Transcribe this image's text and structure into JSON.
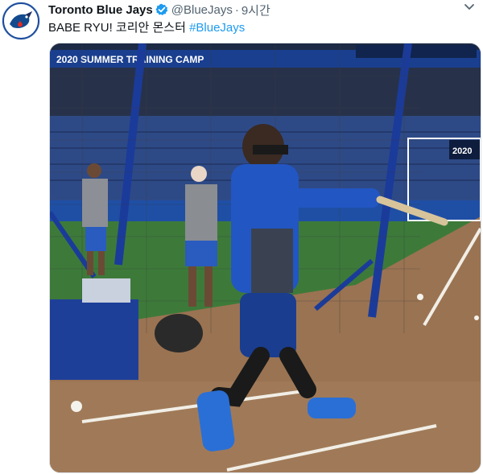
{
  "tweet": {
    "account_name": "Toronto Blue Jays",
    "handle": "@BlueJays",
    "separator": "·",
    "time": "9시간",
    "text_main": "BABE RYU! 코리안 몬스터 ",
    "hashtag": "#BlueJays",
    "verified_color": "#1d9bf0"
  },
  "icons": {
    "avatar": "blue-jays-logo",
    "verified": "verified-badge-icon",
    "more": "chevron-down-icon"
  },
  "media": {
    "banner_text": "2020 SUMMER TRAINING CAMP",
    "scoreboard_text": "2020",
    "jersey_logo": "jays-logo"
  }
}
